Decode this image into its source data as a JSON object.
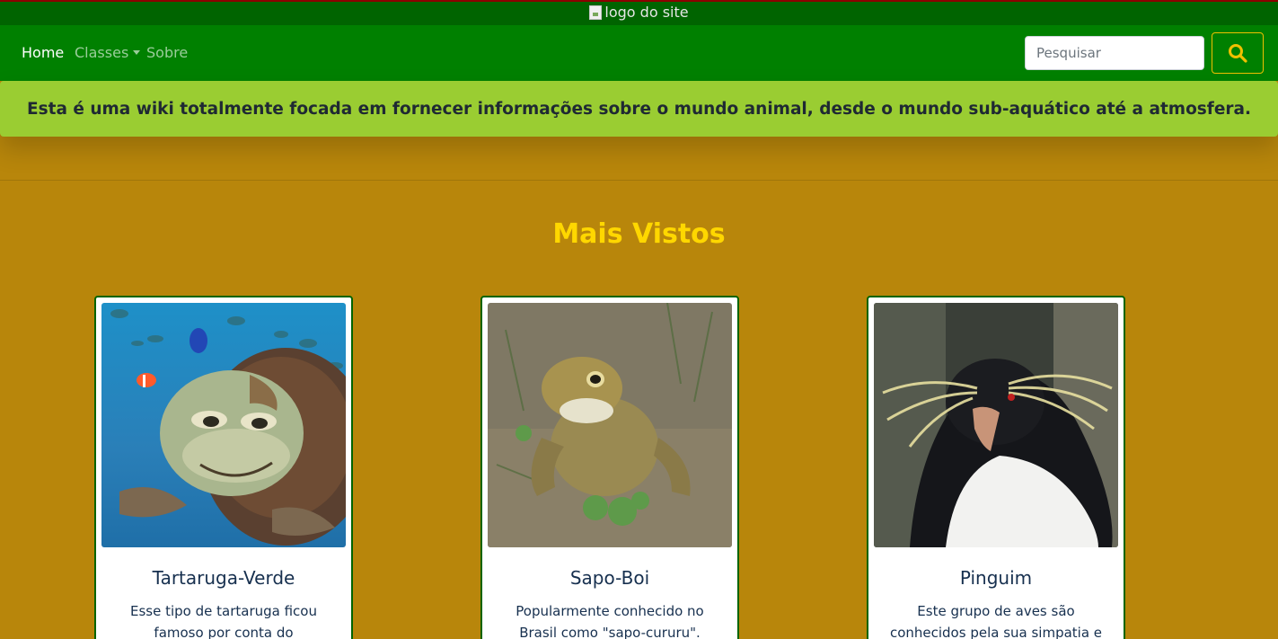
{
  "header": {
    "logo_alt": "logo do site"
  },
  "navbar": {
    "home": "Home",
    "classes": "Classes",
    "about": "Sobre",
    "search_placeholder": "Pesquisar",
    "search_icon": "search-icon"
  },
  "banner": {
    "text": "Esta é uma wiki totalmente focada em fornecer informações sobre o mundo animal, desde o mundo sub-aquático até a atmosfera."
  },
  "section": {
    "title": "Mais Vistos"
  },
  "cards": [
    {
      "title": "Tartaruga-Verde",
      "text": "Esse tipo de tartaruga ficou famoso por conta do",
      "image": "sea-turtle-photo"
    },
    {
      "title": "Sapo-Boi",
      "text": "Popularmente conhecido no Brasil como \"sapo-cururu\".",
      "image": "toad-photo"
    },
    {
      "title": "Pinguim",
      "text": "Este grupo de aves são conhecidos pela sua simpatia e",
      "image": "penguin-photo"
    }
  ],
  "colors": {
    "page_background": "#b8860b",
    "top_bar": "#006400",
    "navbar": "#008000",
    "banner": "#9acd32",
    "accent": "#ffd700",
    "card_border": "#006400"
  }
}
